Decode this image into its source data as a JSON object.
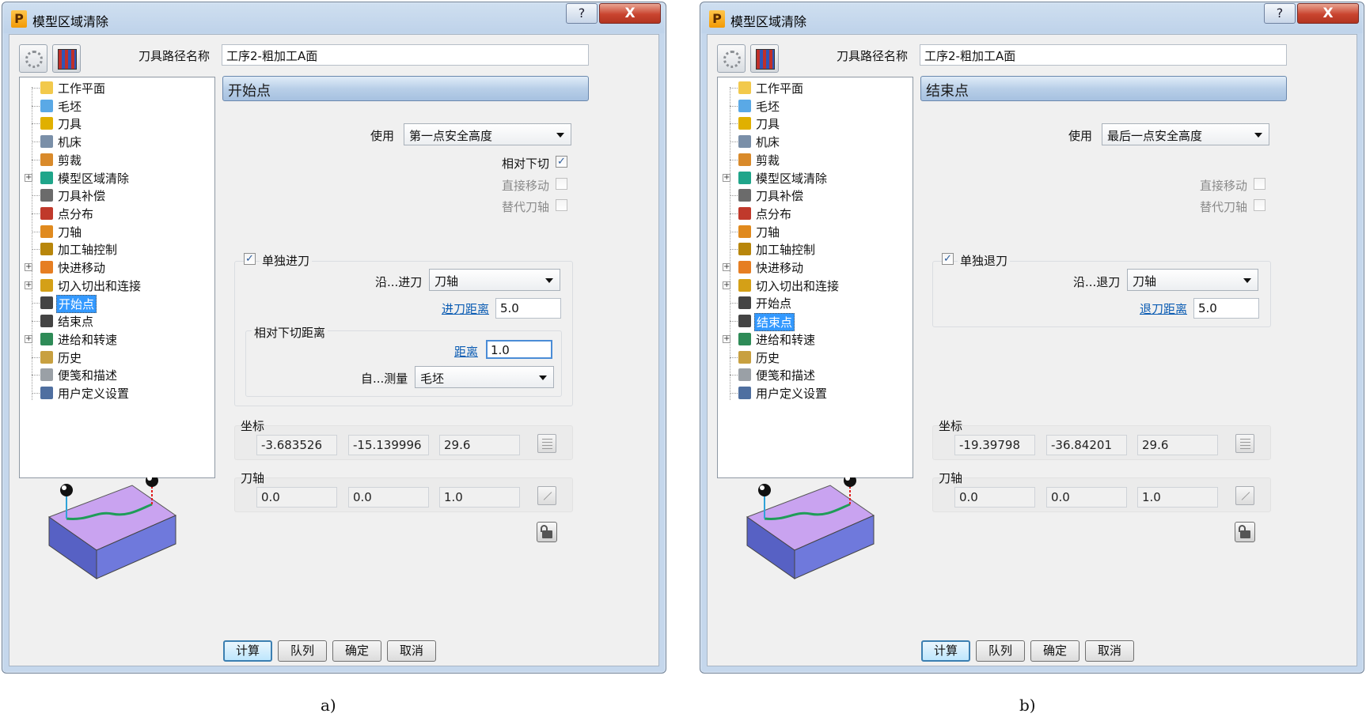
{
  "dialogs": [
    {
      "title": "模型区域清除",
      "help_symbol": "?",
      "close_symbol": "X",
      "toolpath_name_label": "刀具路径名称",
      "toolpath_name_value": "工序2-粗加工A面",
      "tree": [
        {
          "label": "工作平面",
          "icon": "workplane-icon",
          "expandable": false
        },
        {
          "label": "毛坯",
          "icon": "block-icon",
          "expandable": false
        },
        {
          "label": "刀具",
          "icon": "tool-icon",
          "expandable": false
        },
        {
          "label": "机床",
          "icon": "machine-icon",
          "expandable": false
        },
        {
          "label": "剪裁",
          "icon": "trim-icon",
          "expandable": false
        },
        {
          "label": "模型区域清除",
          "icon": "area-clear-icon",
          "expandable": true
        },
        {
          "label": "刀具补偿",
          "icon": "compensation-icon",
          "expandable": false
        },
        {
          "label": "点分布",
          "icon": "point-distribution-icon",
          "expandable": false
        },
        {
          "label": "刀轴",
          "icon": "tool-axis-icon",
          "expandable": false
        },
        {
          "label": "加工轴控制",
          "icon": "axis-control-icon",
          "expandable": false
        },
        {
          "label": "快进移动",
          "icon": "rapid-move-icon",
          "expandable": true
        },
        {
          "label": "切入切出和连接",
          "icon": "leads-links-icon",
          "expandable": true
        },
        {
          "label": "开始点",
          "icon": "start-point-icon",
          "expandable": false
        },
        {
          "label": "结束点",
          "icon": "end-point-icon",
          "expandable": false
        },
        {
          "label": "进给和转速",
          "icon": "feeds-speeds-icon",
          "expandable": true
        },
        {
          "label": "历史",
          "icon": "history-icon",
          "expandable": false
        },
        {
          "label": "便笺和描述",
          "icon": "notes-icon",
          "expandable": false
        },
        {
          "label": "用户定义设置",
          "icon": "user-settings-icon",
          "expandable": false
        }
      ],
      "selected_index": 12,
      "panel_title": "开始点",
      "use_label": "使用",
      "use_value": "第一点安全高度",
      "options": [
        {
          "label": "相对下切",
          "checked": true,
          "enabled": true
        },
        {
          "label": "直接移动",
          "checked": false,
          "enabled": false
        },
        {
          "label": "替代刀轴",
          "checked": false,
          "enabled": false
        }
      ],
      "separate_label": "单独进刀",
      "separate_checked": true,
      "along_label": "沿...进刀",
      "along_value": "刀轴",
      "distance_link": "进刀距离",
      "distance_value": "5.0",
      "relative_group_label": "相对下切距离",
      "rel_distance_link": "距离",
      "rel_distance_value": "1.0",
      "measure_label": "自...测量",
      "measure_value": "毛坯",
      "coord_label": "坐标",
      "coords": [
        "-3.683526",
        "-15.139996",
        "29.6"
      ],
      "axis_label": "刀轴",
      "axis": [
        "0.0",
        "0.0",
        "1.0"
      ],
      "buttons": [
        "计算",
        "队列",
        "确定",
        "取消"
      ],
      "caption": "a)"
    },
    {
      "title": "模型区域清除",
      "help_symbol": "?",
      "close_symbol": "X",
      "toolpath_name_label": "刀具路径名称",
      "toolpath_name_value": "工序2-粗加工A面",
      "tree": [
        {
          "label": "工作平面",
          "icon": "workplane-icon",
          "expandable": false
        },
        {
          "label": "毛坯",
          "icon": "block-icon",
          "expandable": false
        },
        {
          "label": "刀具",
          "icon": "tool-icon",
          "expandable": false
        },
        {
          "label": "机床",
          "icon": "machine-icon",
          "expandable": false
        },
        {
          "label": "剪裁",
          "icon": "trim-icon",
          "expandable": false
        },
        {
          "label": "模型区域清除",
          "icon": "area-clear-icon",
          "expandable": true
        },
        {
          "label": "刀具补偿",
          "icon": "compensation-icon",
          "expandable": false
        },
        {
          "label": "点分布",
          "icon": "point-distribution-icon",
          "expandable": false
        },
        {
          "label": "刀轴",
          "icon": "tool-axis-icon",
          "expandable": false
        },
        {
          "label": "加工轴控制",
          "icon": "axis-control-icon",
          "expandable": false
        },
        {
          "label": "快进移动",
          "icon": "rapid-move-icon",
          "expandable": true
        },
        {
          "label": "切入切出和连接",
          "icon": "leads-links-icon",
          "expandable": true
        },
        {
          "label": "开始点",
          "icon": "start-point-icon",
          "expandable": false
        },
        {
          "label": "结束点",
          "icon": "end-point-icon",
          "expandable": false
        },
        {
          "label": "进给和转速",
          "icon": "feeds-speeds-icon",
          "expandable": true
        },
        {
          "label": "历史",
          "icon": "history-icon",
          "expandable": false
        },
        {
          "label": "便笺和描述",
          "icon": "notes-icon",
          "expandable": false
        },
        {
          "label": "用户定义设置",
          "icon": "user-settings-icon",
          "expandable": false
        }
      ],
      "selected_index": 13,
      "panel_title": "结束点",
      "use_label": "使用",
      "use_value": "最后一点安全高度",
      "options": [
        {
          "label": "直接移动",
          "checked": false,
          "enabled": false
        },
        {
          "label": "替代刀轴",
          "checked": false,
          "enabled": false
        }
      ],
      "separate_label": "单独退刀",
      "separate_checked": true,
      "along_label": "沿...退刀",
      "along_value": "刀轴",
      "distance_link": "退刀距离",
      "distance_value": "5.0",
      "coord_label": "坐标",
      "coords": [
        "-19.39798",
        "-36.84201",
        "29.6"
      ],
      "axis_label": "刀轴",
      "axis": [
        "0.0",
        "0.0",
        "1.0"
      ],
      "buttons": [
        "计算",
        "队列",
        "确定",
        "取消"
      ],
      "caption": "b)"
    }
  ],
  "colors": {
    "selection": "#3399ff",
    "panel_header": "#b9cfe8",
    "link": "#0b5cb3",
    "preview_top": "#c9a3f0",
    "preview_side": "#6670d6"
  }
}
